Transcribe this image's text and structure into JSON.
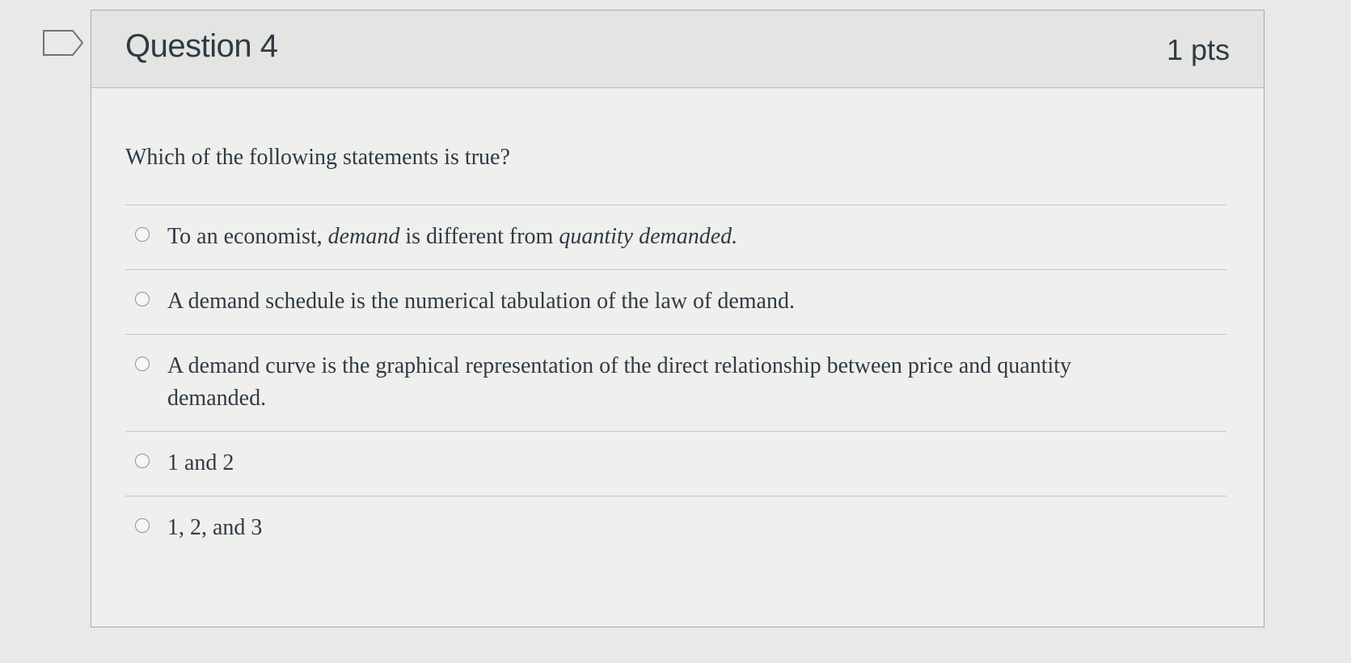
{
  "question": {
    "title": "Question 4",
    "points": "1 pts",
    "prompt": "Which of the following statements is true?"
  },
  "answers": [
    {
      "parts": [
        {
          "text": "To an economist, ",
          "italic": false
        },
        {
          "text": "demand",
          "italic": true
        },
        {
          "text": " is different from ",
          "italic": false
        },
        {
          "text": "quantity demanded.",
          "italic": true
        }
      ]
    },
    {
      "parts": [
        {
          "text": "A demand schedule is the numerical tabulation of the law of demand.",
          "italic": false
        }
      ]
    },
    {
      "parts": [
        {
          "text": "A demand curve is the graphical representation of the direct relationship between price and quantity demanded.",
          "italic": false
        }
      ]
    },
    {
      "parts": [
        {
          "text": "1 and 2",
          "italic": false
        }
      ]
    },
    {
      "parts": [
        {
          "text": "1, 2, and 3",
          "italic": false
        }
      ]
    }
  ],
  "icons": {
    "flag": "flag-question-icon",
    "radio": "radio-button-icon"
  }
}
